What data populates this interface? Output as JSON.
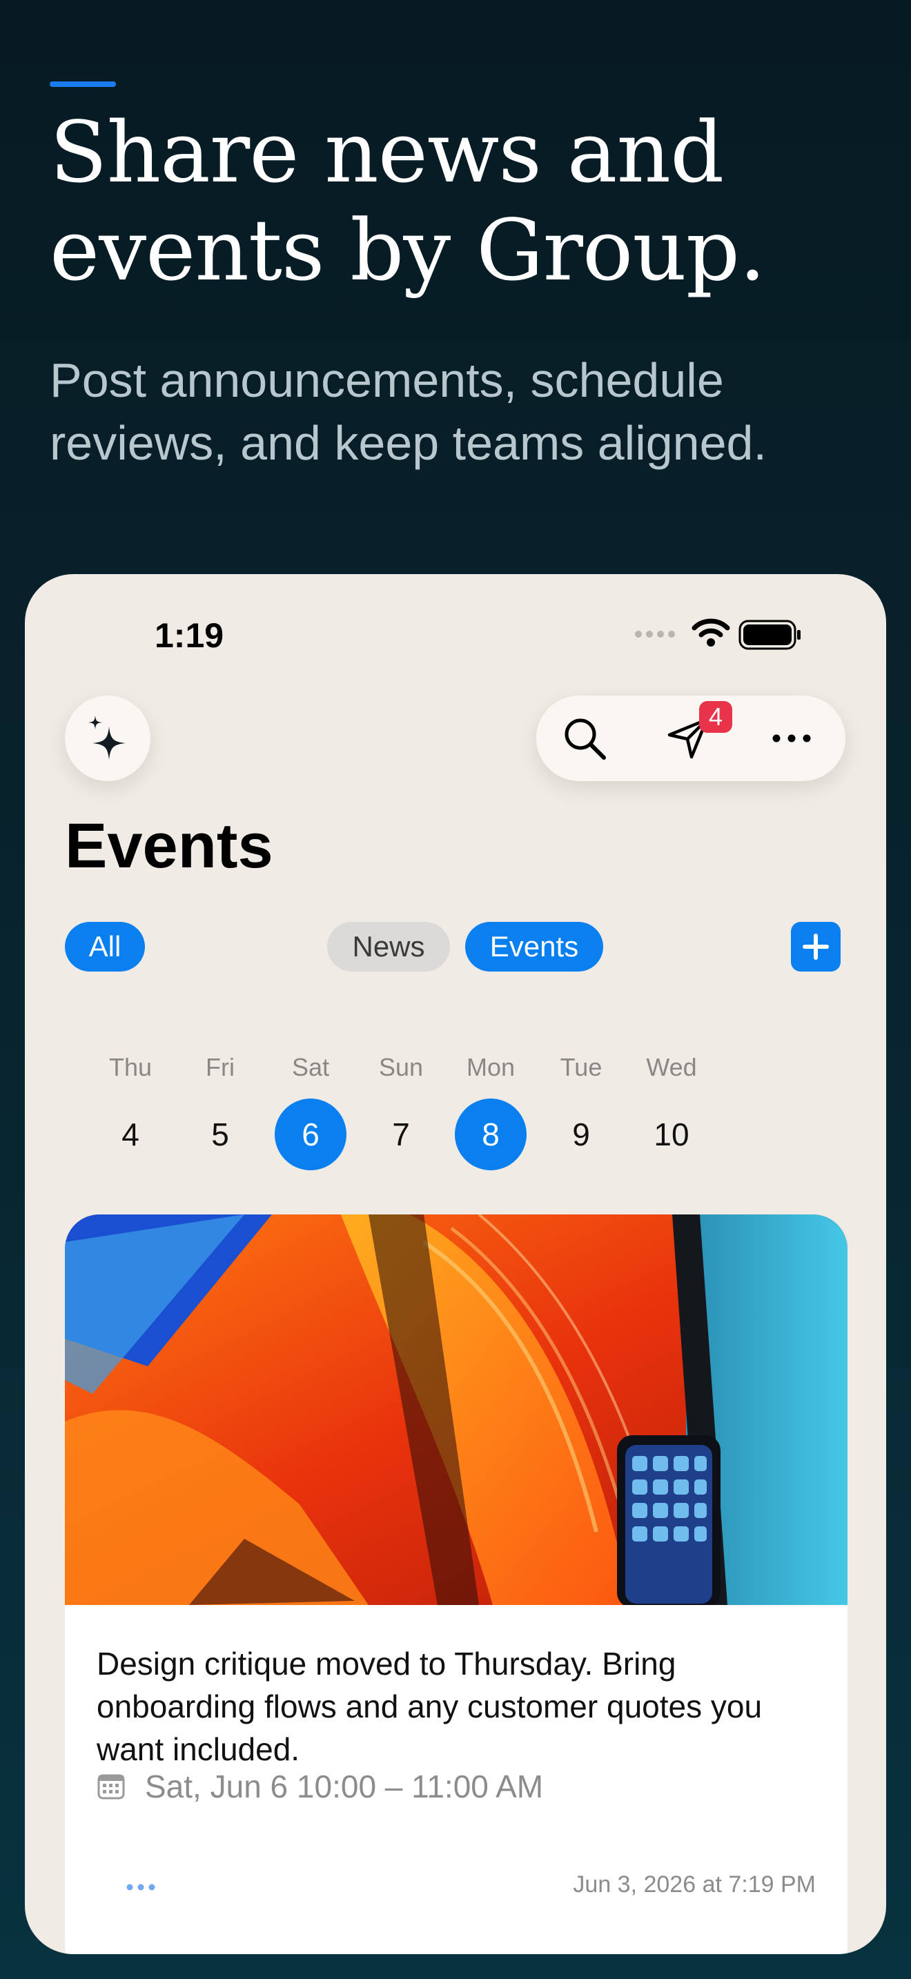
{
  "promo": {
    "headline_line1": "Share news and",
    "headline_line2": "events by Group.",
    "subhead": "Post announcements, schedule reviews, and keep teams aligned."
  },
  "status_bar": {
    "time": "1:19"
  },
  "toolbar": {
    "icons": [
      "sparkle-icon",
      "search-icon",
      "send-icon",
      "more-icon"
    ],
    "badge_count": "4"
  },
  "page": {
    "title": "Events"
  },
  "filters": {
    "all_label": "All",
    "news_label": "News",
    "events_label": "Events"
  },
  "calendar": {
    "days": [
      {
        "dow": "Thu",
        "num": "4"
      },
      {
        "dow": "Fri",
        "num": "5"
      },
      {
        "dow": "Sat",
        "num": "6"
      },
      {
        "dow": "Sun",
        "num": "7"
      },
      {
        "dow": "Mon",
        "num": "8"
      },
      {
        "dow": "Tue",
        "num": "9"
      },
      {
        "dow": "Wed",
        "num": "10"
      }
    ]
  },
  "event_card": {
    "text": "Design critique moved to Thursday. Bring onboarding flows and any customer quotes you want included.",
    "date": "Sat, Jun 6 10:00 – 11:00 AM",
    "timestamp": "Jun 3, 2026 at 7:19 PM"
  },
  "colors": {
    "accent": "#0a7ff0",
    "badge": "#e8334a",
    "background_dark": "#071a22",
    "phone_background": "#f0ebe5"
  }
}
